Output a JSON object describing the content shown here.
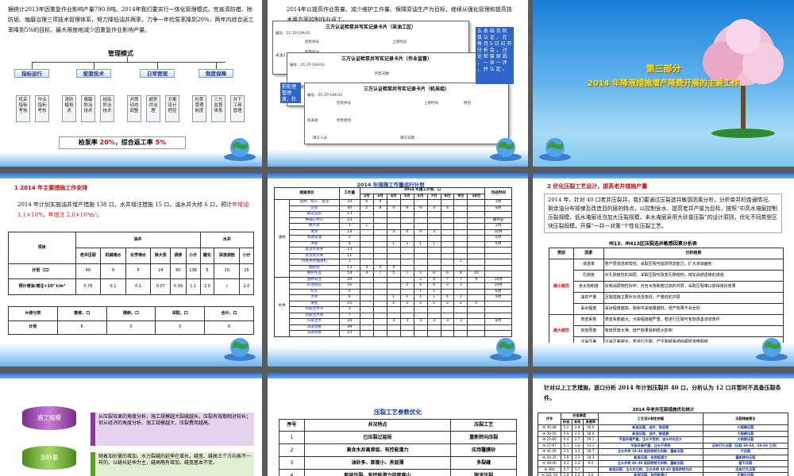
{
  "slide1": {
    "para": "据统计2013年因重复作业影响产量790.8吨。2014年我们要实行一体化管理模式，完善清防蜡、除防垢、偏磨治理三项技术管理体系，努力降低油井两率，力争一年检泵率降到20%，两年内综合返工率降到5%的目标，最大限度地减少因重复作业影响产量。",
    "org_title": "管理模式",
    "categories": [
      "指标运行",
      "配套技术",
      "日常管理",
      "制度保障"
    ],
    "leaves": [
      "机采指标考核",
      "作业指标考核",
      "清防蜡技术",
      "偏磨防治技术",
      "结垢防治技术",
      "井筒动态调整",
      "超常井治理",
      "方案设计把控",
      "检泵管理制度",
      "三方监督体系",
      "井下工具管理"
    ],
    "result_prefix": "检泵率 ",
    "result_rate1": "20%",
    "result_mid": "，综合返工率 ",
    "result_rate2": "5%"
  },
  "slide2": {
    "para": "2014年以提高作业质量、减少维护工作量、保障原油生产为目标，继续从强化管理和提高技术两方面控制作业返工。",
    "form1_title": "三方认证检泵井写实记录卡片（采油工区）",
    "form2_title": "三方认证检泵井写实记录卡片（作业监督）",
    "form3_title": "三方认证检泵井写实记录卡片（机采组）",
    "form_code1": "编号：ZC-ZY-SXK-01",
    "form_code2": "编号：ZC-ZY-SXK-02",
    "form_code3": "编号：ZC-ZY-SXK-03",
    "form_field_well": "检泵井号",
    "form_field_date": "上修时间",
    "form_field_days": "检泵天数",
    "form_field_unit": "所属班站",
    "form_field_person": "写实人",
    "form_field_fill": "填写日期",
    "form_field_cause": "检泵原因",
    "form_field_recorder": "填写人员",
    "form_field_method": "检泵方式",
    "form_field_reason": "原因",
    "form_side_area": "采油工区",
    "form_side_supervise": "作业监督",
    "form_side_machine": "机采组",
    "callout_right": "五 系 结 合 检 泵 认 证 ， 在 每 月 5 日 召 开 分 析 会 ， 讨 论 检 泵 原 因 ， 一 井 一 评 ， 并 认 定 。",
    "callout_left": "前处理 管理 度，杜"
  },
  "slide3": {
    "part": "第三部分",
    "title": "2014 年降液措施增产降费开展的主要工作"
  },
  "slide4": {
    "heading": "1  2014 年主要措施工作安排",
    "para_a": "2014 年计划实施油井增产措施 138 口，水井增注措施 15 口，油水井大修 6 口，预计",
    "para_red1": "年增油 1.1×10⁴t",
    "para_b": "，",
    "para_red2": "年增注 2.0×10⁴m³",
    "para_c": "。",
    "table1_head_item": "项目",
    "table1_group_oil": "油井",
    "table1_group_water": "水井",
    "table1_cols_oil": [
      "老井压裂",
      "机械堵水",
      "化学堵水",
      "换大泵",
      "调参",
      "小计"
    ],
    "table1_cols_water": [
      "酸化",
      "深流调剖",
      "小计"
    ],
    "table1_row1_label": "计划（口）",
    "table1_row1": [
      "40",
      "9",
      "5",
      "24",
      "60",
      "138",
      "5",
      "10",
      "15"
    ],
    "table1_row2_label": "预计增油/增注×10⁴ t/m³",
    "table1_row2": [
      "0.76",
      "0.1",
      "0.1",
      "0.07",
      "0.09",
      "1.1",
      "2.0",
      "/",
      "2.0"
    ],
    "table2_head": [
      "大修分类",
      "套修、口",
      "侧斜、口",
      "深取、口",
      "合计、口"
    ],
    "table2_row_label": "计划",
    "table2_row": [
      "6",
      "0",
      "0",
      "6"
    ]
  },
  "slide5": {
    "title": "2014 年措施工作量运行计划",
    "col_item": "措施项目",
    "col_total": "工作量",
    "col_plan": "2014 年施工计划、口",
    "col_done": "完成时间",
    "months": [
      "2月",
      "3月",
      "4月",
      "5月",
      "6月",
      "7月",
      "8月",
      "9月",
      "10月"
    ],
    "group_oil": "油井",
    "group_water": "水井",
    "rows": [
      {
        "name": "钻井、校产、投注",
        "total": "10",
        "m": [
          "6",
          "4",
          "",
          "",
          "",
          "",
          "",
          "",
          ""
        ],
        "done": "3月"
      },
      {
        "name": "压裂",
        "total": "40",
        "m": [
          "2",
          "8",
          "4",
          "9",
          "9",
          "4",
          "4",
          "",
          ""
        ],
        "done": "8月"
      },
      {
        "name": "备选压裂",
        "total": "13",
        "m": [
          "",
          "",
          "",
          "",
          "",
          "",
          "",
          "",
          ""
        ],
        "done": ""
      },
      {
        "name": "换偏心井口",
        "total": "23",
        "m": [
          "",
          "",
          "",
          "",
          "",
          "",
          "",
          "",
          ""
        ],
        "done": "随作业"
      },
      {
        "name": "换大泵",
        "total": "1",
        "m": [
          "1",
          "",
          "",
          "",
          "",
          "",
          "",
          "",
          ""
        ],
        "done": "2月"
      },
      {
        "name": "堵水",
        "total": "14",
        "m": [
          "",
          "",
          "3",
          "4",
          "4",
          "3",
          "",
          "",
          ""
        ],
        "done": "10月"
      },
      {
        "name": "周期采油",
        "total": "3",
        "m": [
          "",
          "",
          "",
          "",
          "",
          "",
          "",
          "",
          ""
        ],
        "done": "6月"
      },
      {
        "name": "大修",
        "total": "4",
        "m": [
          "",
          "",
          "1",
          "1",
          "1",
          "1",
          "",
          "",
          ""
        ],
        "done": "6月"
      },
      {
        "name": "高含水关井",
        "total": "13",
        "m": [
          "",
          "",
          "",
          "",
          "",
          "",
          "",
          "",
          ""
        ],
        "done": ""
      },
      {
        "name": "高含水开井",
        "total": "11",
        "m": [
          "",
          "",
          "",
          "",
          "",
          "",
          "",
          "",
          ""
        ],
        "done": ""
      },
      {
        "name": "待关井转抽油机",
        "total": "1",
        "m": [
          "",
          "",
          "",
          "",
          "",
          "",
          "",
          "1",
          ""
        ],
        "done": ""
      },
      {
        "name": "抽转捞",
        "total": "13",
        "m": [
          "4",
          "5",
          "4",
          "",
          "",
          "",
          "",
          "",
          ""
        ],
        "done": ""
      },
      {
        "name": "维护作业",
        "total": "54",
        "m": [
          "4",
          "7",
          "5",
          "7",
          "1",
          "6",
          "6",
          "8",
          "10"
        ],
        "done": ""
      },
      {
        "name": "油井转注",
        "total": "29",
        "m": [
          "",
          "",
          "",
          "",
          "2",
          "4",
          "7",
          "7",
          "9"
        ],
        "done": "10月"
      },
      {
        "name": "挤液除压",
        "total": "16",
        "m": [
          "",
          "",
          "",
          "3",
          "4",
          "4",
          "3",
          "2",
          ""
        ],
        "done": "10月"
      },
      {
        "name": "补孔",
        "total": "2",
        "m": [
          "",
          "",
          "",
          "",
          "1",
          "1",
          "",
          "",
          ""
        ],
        "done": "6月"
      },
      {
        "name": "大修",
        "total": "6",
        "m": [
          "",
          "",
          "1",
          "1",
          "1",
          "1",
          "1",
          "1",
          ""
        ],
        "done": "9月"
      },
      {
        "name": "重配",
        "total": "15",
        "m": [
          "",
          "",
          "2",
          "2",
          "2",
          "1",
          "2",
          "2",
          "2"
        ],
        "done": ""
      },
      {
        "name": "周期注水开",
        "total": "3",
        "m": [
          "",
          "",
          "",
          "",
          "",
          "",
          "",
          "",
          ""
        ],
        "done": ""
      },
      {
        "name": "周期注水关",
        "total": "7",
        "m": [
          "",
          "",
          "",
          "",
          "",
          "",
          "",
          "",
          ""
        ],
        "done": ""
      },
      {
        "name": "分层注水",
        "total": "18",
        "m": [
          "",
          "",
          "3",
          "3",
          "3",
          "3",
          "3",
          "3",
          ""
        ],
        "done": "8月"
      },
      {
        "name": "测试调整",
        "total": "49",
        "m": [
          "",
          "",
          "",
          "",
          "",
          "",
          "",
          "",
          ""
        ],
        "done": ""
      },
      {
        "name": "洗收调整",
        "total": "23",
        "m": [
          "",
          "",
          "",
          "",
          "",
          "",
          "",
          "",
          ""
        ],
        "done": ""
      }
    ]
  },
  "slide6": {
    "heading": "2  优化压裂工艺设计，提高老井措施产量",
    "para": "2014 年，针对 40 口老井压裂井，我们要通过压裂选井敏感因素分析，分析单井的连通情况、剩余油分布规律及改造目的层的特点，以控制含水、提高老井产量为目标，按照“中高水淹层控制压裂规模，低水淹层适当加大压裂规模，未水淹层采用大砂量压裂”的设计原则，优化不同类型区块压裂规模，开展“一井一对策”个性化压裂工艺。",
    "table_title": "州13、州413区压裂选井敏感因素分析表",
    "col_type": "类别",
    "col_factor": "因素",
    "col_result": "分析结果",
    "group_a": "越小越优",
    "group_b": "越大越优",
    "rows": [
      {
        "factor": "渗透率",
        "result": "若产层渗透率较低，采取压裂可提高导流能力，扩大渗油面积"
      },
      {
        "factor": "孔隙度",
        "result": "对孔隙度低的油层，采取压裂可改变孔隙结构，增加油通透率的通道"
      },
      {
        "factor": "含水饱和度",
        "result": "反映油层物性好坏，对含水饱和度过高的井层，采取压裂难以获得良好效果"
      },
      {
        "factor": "油井产量",
        "result": "压裂措施主要针对渗透率低、产量低的井层"
      },
      {
        "factor": "采出程度",
        "result": "采出程度越高，剩余可采储量越低，增产效果不会太好"
      },
      {
        "factor": "表皮系数",
        "result": "表皮系数越大，污染程度越严重，若进行压裂可有效改善渗流条件"
      },
      {
        "factor": "有效厚度",
        "result": "有效厚度大薄，增产效果受到很大影响"
      },
      {
        "factor": "注采压差",
        "result": "注采压差越大，若进行压裂，产生裂缝易通挡或抵渗带裂缝"
      }
    ]
  },
  "slide7": {
    "cyl1": "施工规模",
    "cyl2": "加砂量",
    "text1": "从压裂效果的角度分析，施工规模越大裂缝越长，压裂有效期相对较长；但从经济的角度分析，施工规模越大，压裂费用越高。",
    "text2": "随着加砂量的增加，水力裂缝的延伸在增长，缝宽、缝高三个方向表不一样的，以缝长延伸为主，缝高略有增加，缝宽基本不变。"
  },
  "slide8": {
    "title": "压裂工艺参数优化",
    "col_no": "序号",
    "col_type": "井况特点",
    "col_proc": "压裂工艺",
    "rows": [
      {
        "no": "1",
        "type": "已压裂过层段",
        "proc": "重新转向压裂"
      },
      {
        "no": "2",
        "type": "高含水井高渗层、有控能潜力",
        "proc": "应用覆膜砂"
      },
      {
        "no": "3",
        "type": "油砂多、厚度小、夹层薄",
        "proc": "多裂缝"
      },
      {
        "no": "4",
        "type": "新层压裂、有控能潜力但厚度小",
        "proc": "限流压裂"
      }
    ]
  },
  "slide9": {
    "para": "针对以上工艺措施，逐口分析 2014 年计划压裂井 40 口，分析认为 12 口井暂时不具备压裂条件。",
    "table_title": "2014 年老井压裂措施优化统计",
    "col_well": "井号",
    "col_area": "砂层厚度",
    "col_params": [
      "砂岩",
      "有效",
      "渗透率"
    ],
    "col_plan": "工艺设计制定依据",
    "col_note": "压裂措施意见",
    "rows": [
      {
        "well": "州 30-48",
        "a": "5.2",
        "b": "2.8",
        "c": "16.0",
        "plan": "新层压裂、选井、换层替",
        "note": "大规模压裂"
      },
      {
        "well": "州 30-50",
        "a": "4.9",
        "b": "2.5",
        "c": "18.0",
        "plan": "新层压裂、选井、换层替",
        "note": "大规模压裂"
      },
      {
        "well": "州 24-60",
        "a": "6.4",
        "b": "2.7",
        "c": "19.1",
        "plan": "平面矛盾严重、注水不受效、油水井对应大",
        "note": "大规模压裂"
      },
      {
        "well": "州 27-67",
        "a": "5.1",
        "b": "1.6",
        "c": "13.1",
        "plan": "平面矛盾严重、注水不受效",
        "note": "没有打孔压裂（压裂 19-64、20-64 之间）"
      },
      {
        "well": "州 41-45",
        "a": "3.5",
        "b": "3.2",
        "c": "16.7",
        "plan": "注水井转 19-44 层段转转为间断、重新压裂",
        "note": "不压裂"
      },
      {
        "well": "州 44-35",
        "a": "3.0",
        "b": "1.3",
        "c": "18.3",
        "plan": "新层压裂、有控能潜力",
        "note": "重新转向压裂"
      },
      {
        "well": "州 48-40",
        "a": "4.3",
        "b": "2.4",
        "c": "9.0",
        "plan": "注水井转 46-38 层段转转为间断、重新压裂",
        "note": "暂不压裂"
      },
      {
        "well": "州 484",
        "a": "4.7",
        "b": "1.7",
        "c": "",
        "plan": "新层压裂、注水井已转、注水井转 49-43 层段转转为间",
        "note": "没有打孔压裂"
      },
      {
        "well": "州 541-16",
        "a": "5.9",
        "b": "2.0",
        "c": "5.0",
        "plan": "新层压裂、有控能潜力",
        "note": "不建议压裂"
      },
      {
        "well": "州 42-49",
        "a": "4.3",
        "b": "3.3",
        "c": "3.1",
        "plan": "新层压裂、有控能潜力",
        "note": "没有打孔压裂"
      }
    ]
  },
  "colors": {
    "accent_blue": "#2f64c8",
    "red": "#d01010",
    "title_yellow": "#f8e020",
    "sky": "#6fb3ea"
  }
}
